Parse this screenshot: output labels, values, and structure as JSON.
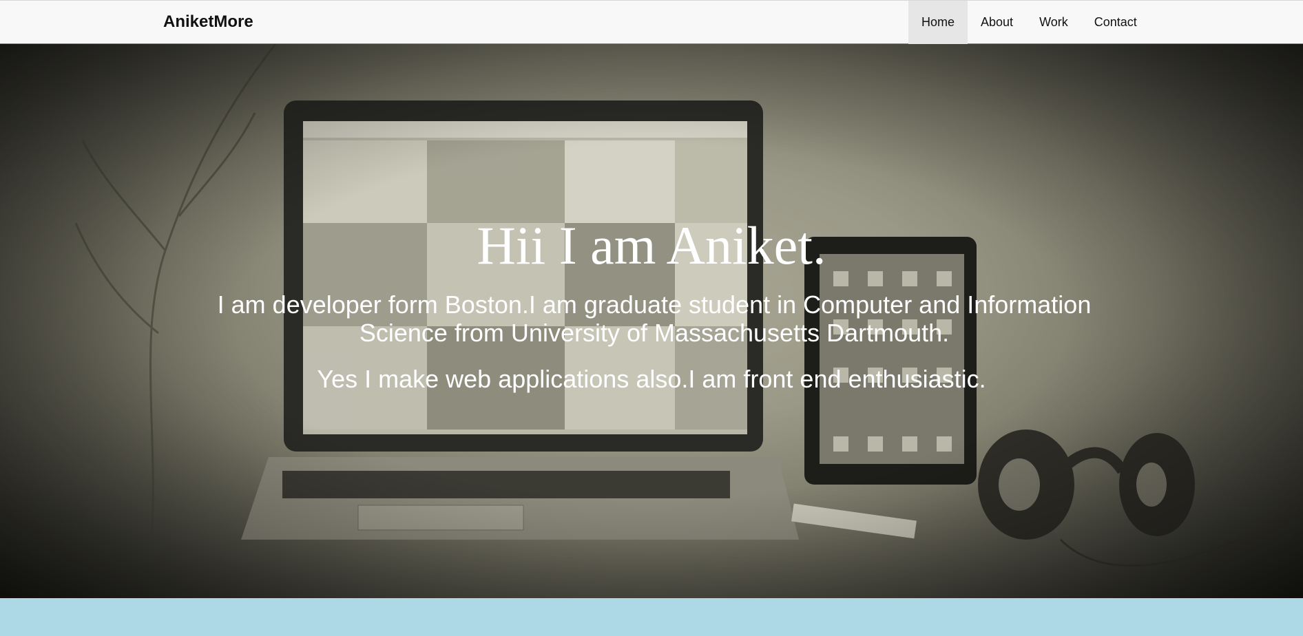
{
  "brand": "AniketMore",
  "nav": {
    "items": [
      "Home",
      "About",
      "Work",
      "Contact"
    ],
    "active": "Home"
  },
  "hero": {
    "title": "Hii I am Aniket.",
    "paragraph1": "I am developer form Boston.I am graduate student in Computer and Information Science from University of Massachusetts Dartmouth.",
    "paragraph2": "Yes I make web applications also.I am front end enthusiastic."
  },
  "colors": {
    "navbar_bg": "#f8f8f8",
    "nav_active_bg": "#e6e6e6",
    "page_bg": "#add8e6",
    "hero_text": "#ffffff"
  }
}
